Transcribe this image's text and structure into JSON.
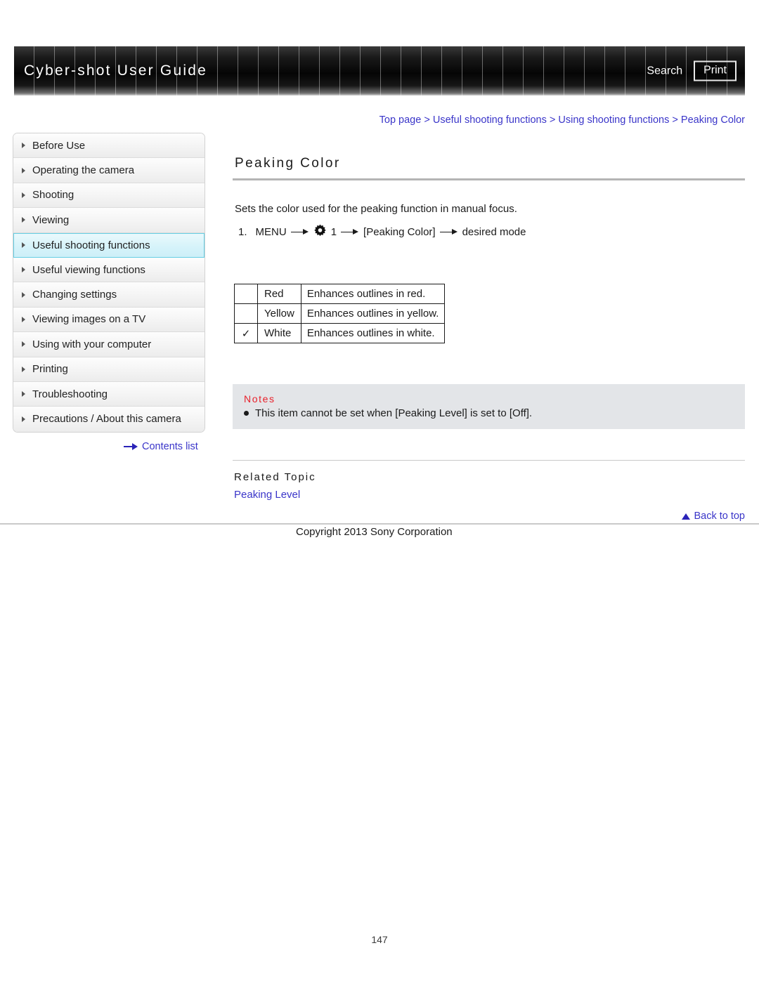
{
  "header": {
    "title": "Cyber-shot User Guide",
    "search_label": "Search",
    "print_label": "Print"
  },
  "breadcrumb": {
    "items": [
      {
        "label": "Top page"
      },
      {
        "label": "Useful shooting functions"
      },
      {
        "label": "Using shooting functions"
      },
      {
        "label": "Peaking Color"
      }
    ],
    "separator": ">"
  },
  "sidebar": {
    "items": [
      {
        "label": "Before Use",
        "active": false
      },
      {
        "label": "Operating the camera",
        "active": false
      },
      {
        "label": "Shooting",
        "active": false
      },
      {
        "label": "Viewing",
        "active": false
      },
      {
        "label": "Useful shooting functions",
        "active": true
      },
      {
        "label": "Useful viewing functions",
        "active": false
      },
      {
        "label": "Changing settings",
        "active": false
      },
      {
        "label": "Viewing images on a TV",
        "active": false
      },
      {
        "label": "Using with your computer",
        "active": false
      },
      {
        "label": "Printing",
        "active": false
      },
      {
        "label": "Troubleshooting",
        "active": false
      },
      {
        "label": "Precautions / About this camera",
        "active": false
      }
    ],
    "contents_link": "Contents list"
  },
  "main": {
    "title": "Peaking Color",
    "lead": "Sets the color used for the peaking function in manual focus.",
    "step": {
      "number": "1.",
      "menu_label": "MENU",
      "gear_icon": "gear-icon",
      "menu_tab": "1",
      "item_label": "[Peaking Color]",
      "result_label": "desired mode"
    },
    "options_table": {
      "rows": [
        {
          "checked": "",
          "name": "Red",
          "description": "Enhances outlines in red."
        },
        {
          "checked": "",
          "name": "Yellow",
          "description": "Enhances outlines in yellow."
        },
        {
          "checked": "✓",
          "name": "White",
          "description": "Enhances outlines in white."
        }
      ]
    },
    "notes": {
      "title": "Notes",
      "items": [
        "This item cannot be set when [Peaking Level] is set to [Off]."
      ]
    },
    "related": {
      "title": "Related Topic",
      "links": [
        {
          "label": "Peaking Level"
        }
      ]
    }
  },
  "footer": {
    "back_to_top": "Back to top",
    "copyright": "Copyright 2013 Sony Corporation",
    "page_number": "147"
  },
  "colors": {
    "link": "#3a35c9",
    "notes_title": "#e8212b",
    "active_nav_border": "#66cfe4",
    "notes_background": "#e3e5e8"
  }
}
